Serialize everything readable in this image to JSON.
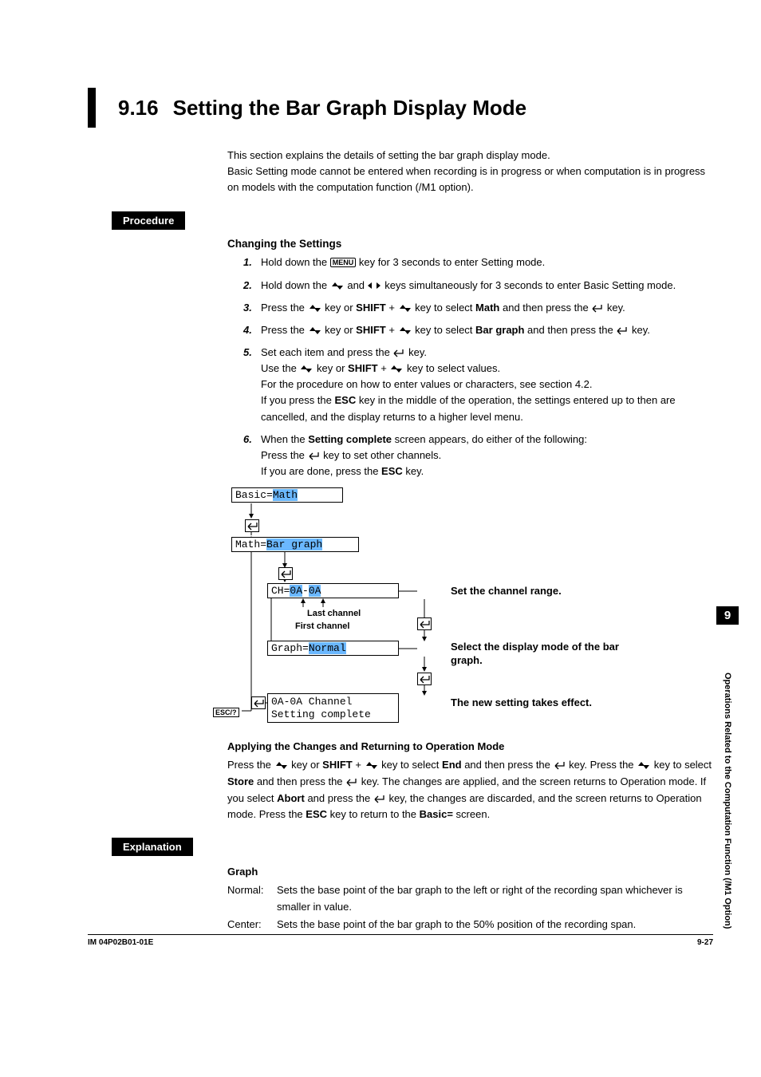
{
  "section_number": "9.16",
  "section_title": "Setting the Bar Graph Display Mode",
  "intro": "This section explains the details of setting the bar graph display mode.\nBasic Setting mode cannot be entered when recording is in progress or when computation is in progress on models with the computation function (/M1 option).",
  "procedure_label": "Procedure",
  "changing_title": "Changing the Settings",
  "steps": {
    "s1_a": "Hold down the ",
    "s1_menu": "MENU",
    "s1_b": " key for 3 seconds to enter Setting mode.",
    "s2_a": "Hold down the ",
    "s2_b": " and ",
    "s2_c": " keys simultaneously for 3 seconds to enter Basic Setting mode.",
    "s3_a": "Press the ",
    "s3_b": " key or ",
    "s3_shift": "SHIFT",
    "s3_c": " + ",
    "s3_d": " key to select ",
    "s3_math": "Math",
    "s3_e": " and then press the ",
    "s3_f": " key.",
    "s4_a": "Press the ",
    "s4_b": " key or ",
    "s4_shift": "SHIFT",
    "s4_c": " + ",
    "s4_d": " key to select ",
    "s4_bar": "Bar graph",
    "s4_e": " and then press the ",
    "s4_f": " key.",
    "s5_a": "Set each item and press the ",
    "s5_b": " key.",
    "s5_c": "Use the ",
    "s5_d": " key or ",
    "s5_shift": "SHIFT",
    "s5_e": " + ",
    "s5_f": " key to select values.",
    "s5_g": "For the procedure on how to enter values or characters, see section 4.2.",
    "s5_h": "If you press the ",
    "s5_esc": "ESC",
    "s5_i": " key in the middle of the operation, the settings entered up to then are cancelled, and the display returns to a higher level menu.",
    "s6_a": "When the ",
    "s6_sc": "Setting complete",
    "s6_b": " screen appears, do either of the following:",
    "s6_c": "Press the ",
    "s6_d": " key to set other channels.",
    "s6_e": "If you are done, press the ",
    "s6_esc": "ESC",
    "s6_f": " key."
  },
  "diagram": {
    "basic_pre": "Basic=",
    "basic_val": "Math",
    "math_pre": "Math=",
    "math_val": "Bar graph",
    "ch_pre": "CH=",
    "ch_v1": "0A",
    "ch_dash": "-",
    "ch_v2": "0A",
    "last": "Last channel",
    "first": "First channel",
    "graph_pre": "Graph=",
    "graph_val": "Normal",
    "done1": "0A-0A Channel",
    "done2": "Setting complete",
    "esc": "ESC/?",
    "lab_ch": "Set the channel range.",
    "lab_graph": "Select the display mode of the bar graph.",
    "lab_done": "The new setting takes effect."
  },
  "apply_title": "Applying the Changes and Returning to Operation Mode",
  "apply": {
    "a": "Press the ",
    "b": " key or ",
    "shift": "SHIFT",
    "c": " + ",
    "d": " key to select ",
    "end": "End",
    "e": " and then press the ",
    "f": " key. Press the ",
    "g": " key to select ",
    "store": "Store",
    "h": " and then press the ",
    "i": " key. The changes are applied, and the screen returns to Operation mode. If you select ",
    "abort": "Abort",
    "j": " and press the ",
    "k": " key, the changes are discarded, and the screen returns to Operation mode. Press the ",
    "esc": "ESC",
    "l": " key to return to the ",
    "basic": "Basic=",
    "m": " screen."
  },
  "explanation_label": "Explanation",
  "graph_title": "Graph",
  "graph_normal_key": "Normal:",
  "graph_normal_val": "Sets the base point of the bar graph to the left or right of the recording span whichever is smaller in value.",
  "graph_center_key": "Center:",
  "graph_center_val": "Sets the base point of the bar graph to the 50% position of the recording span.",
  "side_num": "9",
  "side_text": "Operations Related to the Computation Function (/M1 Option)",
  "footer_left": "IM 04P02B01-01E",
  "footer_right": "9-27"
}
